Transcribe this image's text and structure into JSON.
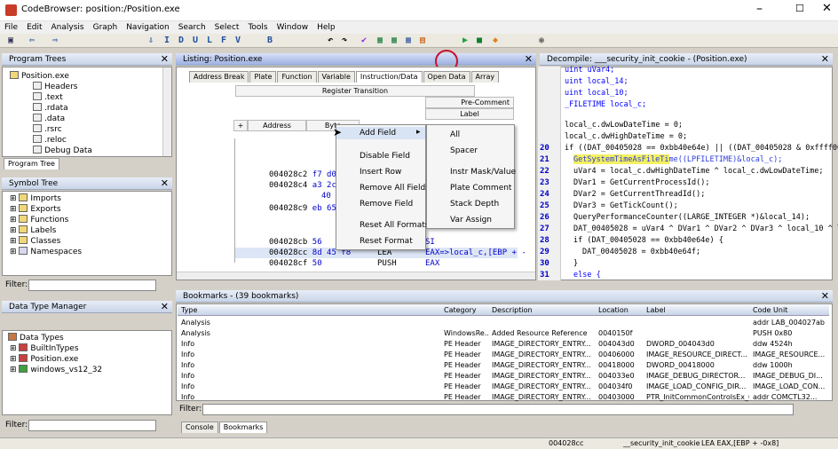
{
  "window": {
    "title": "CodeBrowser: position:/Position.exe"
  },
  "menu": [
    "File",
    "Edit",
    "Analysis",
    "Graph",
    "Navigation",
    "Search",
    "Select",
    "Tools",
    "Window",
    "Help"
  ],
  "toolbar_letters": [
    "I",
    "D",
    "U",
    "L",
    "F",
    "V",
    "B"
  ],
  "program_trees": {
    "title": "Program Trees",
    "items": [
      "Position.exe",
      "Headers",
      ".text",
      ".rdata",
      ".data",
      ".rsrc",
      ".reloc",
      "Debug Data"
    ],
    "tab": "Program Tree"
  },
  "symbol_tree": {
    "title": "Symbol Tree",
    "items": [
      "Imports",
      "Exports",
      "Functions",
      "Labels",
      "Classes",
      "Namespaces"
    ],
    "filter_label": "Filter:"
  },
  "data_type_manager": {
    "title": "Data Type Manager",
    "items": [
      "Data Types",
      "BuiltInTypes",
      "Position.exe",
      "windows_vs12_32"
    ],
    "filter_label": "Filter:"
  },
  "listing": {
    "title": "Listing:  Position.exe",
    "tabs": [
      "Address Break",
      "Plate",
      "Function",
      "Variable",
      "Instruction/Data",
      "Open Data",
      "Array"
    ],
    "selected_tab": "Instruction/Data",
    "fields": {
      "register_transition": "Register Transition",
      "pre_comment": "Pre-Comment",
      "label": "Label",
      "address": "Address",
      "bytes": "Byte",
      "plus": "+"
    },
    "rows": [
      {
        "addr": "004028c2",
        "bytes": "f7 d0"
      },
      {
        "addr": "004028c4",
        "bytes": "a3 2c"
      },
      {
        "addr": "",
        "bytes": "40 00"
      },
      {
        "addr": "004028c9",
        "bytes": "eb 65"
      },
      {
        "addr": "004028cb",
        "bytes": "56",
        "op": "",
        "arg": "SI"
      },
      {
        "addr": "004028cc",
        "bytes": "8d 45 f8",
        "op": "LEA",
        "arg": "EAX=>local_c,[EBP + -"
      },
      {
        "addr": "004028cf",
        "bytes": "50",
        "op": "PUSH",
        "arg": "EAX"
      }
    ]
  },
  "context_menu": {
    "items": [
      "Add Field",
      "Disable Field",
      "Insert Row",
      "Remove All Fields",
      "Remove Field",
      "Reset All Formats",
      "Reset Format"
    ],
    "submenu": [
      "All",
      "Spacer",
      "Instr Mask/Value",
      "Plate Comment",
      "Stack Depth",
      "Var Assign"
    ]
  },
  "decompile": {
    "title": "Decompile: ___security_init_cookie - (Position.exe)",
    "line_numbers": [
      "",
      "",
      "",
      "",
      "",
      "",
      "",
      "",
      "",
      "",
      "20",
      "21",
      "22",
      "23",
      "24",
      "25",
      "26",
      "27",
      "28",
      "29",
      "30",
      "31"
    ],
    "lines": [
      "uint uVar4;",
      "uint local_14;",
      "uint local_10;",
      "_FILETIME local_c;",
      "",
      "local_c.dwLowDateTime = 0;",
      "local_c.dwHighDateTime = 0;",
      "if ((DAT_00405028 == 0xbb40e64e) || ((DAT_00405028 & 0xffff000",
      "GetSystemTimeAsFileTime((LPFILETIME)&local_c);",
      "uVar4 = local_c.dwHighDateTime ^ local_c.dwLowDateTime;",
      "DVar1 = GetCurrentProcessId();",
      "DVar2 = GetCurrentThreadId();",
      "DVar3 = GetTickCount();",
      "QueryPerformanceCounter((LARGE_INTEGER *)&local_14);",
      "DAT_00405028 = uVar4 ^ DVar1 ^ DVar2 ^ DVar3 ^ local_10 ^ l",
      "if (DAT_00405028 == 0xbb40e64e) {",
      "DAT_00405028 = 0xbb40e64f;",
      "}",
      "else {"
    ]
  },
  "bookmarks": {
    "title": "Bookmarks - (39 bookmarks)",
    "columns": [
      "Type",
      "Category",
      "Description",
      "Location",
      "Label",
      "Code Unit"
    ],
    "rows": [
      [
        "Analysis",
        "",
        "",
        "",
        "",
        "addr LAB_004027ab"
      ],
      [
        "Analysis",
        "WindowsRe...",
        "Added Resource Reference",
        "0040150f",
        "",
        "PUSH 0x80"
      ],
      [
        "Info",
        "PE Header",
        "IMAGE_DIRECTORY_ENTRY...",
        "004043d0",
        "DWORD_004043d0",
        "ddw 4524h"
      ],
      [
        "Info",
        "PE Header",
        "IMAGE_DIRECTORY_ENTRY...",
        "00406000",
        "IMAGE_RESOURCE_DIRECT...",
        "IMAGE_RESOURCE..."
      ],
      [
        "Info",
        "PE Header",
        "IMAGE_DIRECTORY_ENTRY...",
        "00418000",
        "DWORD_00418000",
        "ddw 1000h"
      ],
      [
        "Info",
        "PE Header",
        "IMAGE_DIRECTORY_ENTRY...",
        "004033e0",
        "IMAGE_DEBUG_DIRECTOR...",
        "IMAGE_DEBUG_DI..."
      ],
      [
        "Info",
        "PE Header",
        "IMAGE_DIRECTORY_ENTRY...",
        "004034f0",
        "IMAGE_LOAD_CONFIG_DIR...",
        "IMAGE_LOAD_CON..."
      ],
      [
        "Info",
        "PE Header",
        "IMAGE_DIRECTORY_ENTRY...",
        "00403000",
        "PTR_InitCommonControlsEx_0...",
        "addr COMCTL32..."
      ]
    ],
    "filter_label": "Filter:",
    "tabs": [
      "Console",
      "Bookmarks"
    ]
  },
  "status": {
    "address": "004028cc",
    "function": "__security_init_cookie",
    "instruction": "LEA EAX,[EBP + -0x8]"
  },
  "colors": {
    "accent": "#c8102e",
    "header": "#c8d4e8",
    "selected_row": "#dde6f6"
  }
}
